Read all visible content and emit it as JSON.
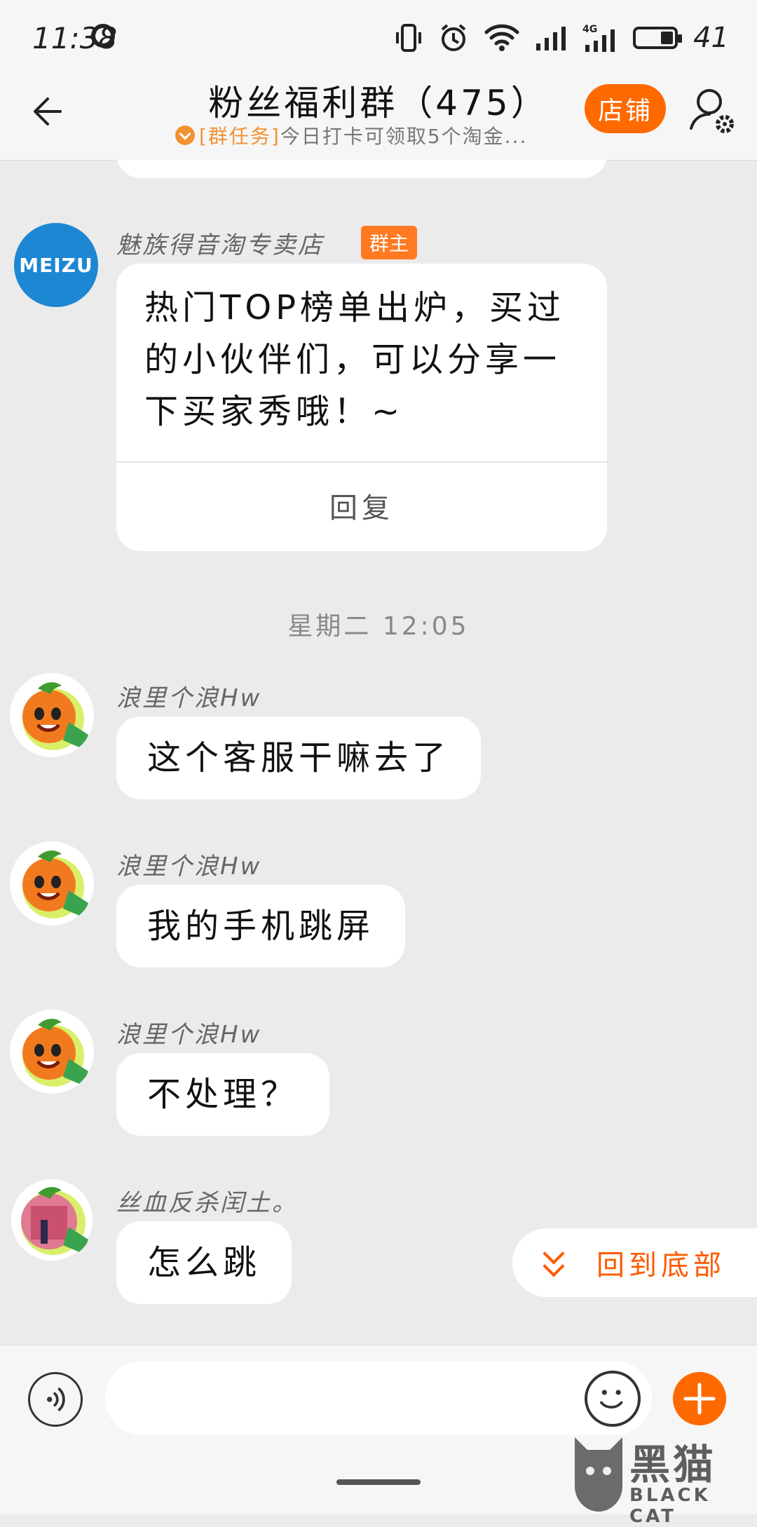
{
  "status_bar": {
    "time": "11:38",
    "battery": "41",
    "network": "4G"
  },
  "header": {
    "title": "粉丝福利群（475）",
    "subtitle_task": "[群任务]",
    "subtitle_text": "今日打卡可领取5个淘金...",
    "shop_label": "店铺"
  },
  "messages": [
    {
      "sender": "魅族得音淘专卖店",
      "badge": "群主",
      "avatar_text": "MEIZU",
      "text": "热门TOP榜单出炉，买过的小伙伴们，可以分享一下买家秀哦！~",
      "reply_label": "回复"
    },
    {
      "sender": "浪里个浪Hw",
      "text": "这个客服干嘛去了"
    },
    {
      "sender": "浪里个浪Hw",
      "text": "我的手机跳屏"
    },
    {
      "sender": "浪里个浪Hw",
      "text": "不处理？"
    },
    {
      "sender": "丝血反杀闰土。",
      "text": "怎么跳"
    }
  ],
  "timestamp": "星期二 12:05",
  "back_to_bottom_label": "回到底部",
  "watermark": {
    "text": "黑猫",
    "sub": "BLACK CAT"
  },
  "colors": {
    "accent": "#ff6a00",
    "task": "#f39232",
    "background": "#ebebeb"
  }
}
